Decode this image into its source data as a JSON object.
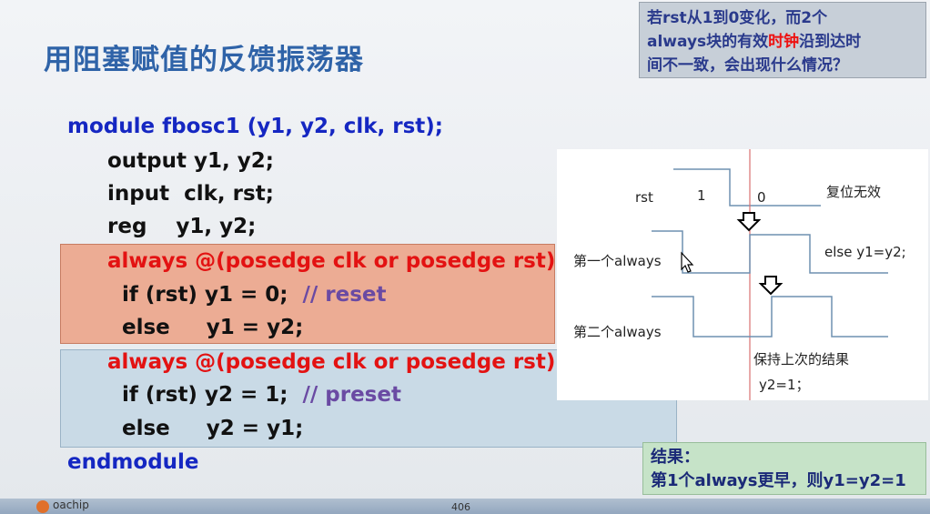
{
  "title": "用阻塞赋值的反馈振荡器",
  "note": {
    "line1": "若rst从1到0变化，而2个",
    "line2_pre": "always块的有效",
    "line2_red": "时钟",
    "line2_post": "沿到达时",
    "line3": "间不一致，会出现什么情况？"
  },
  "code": {
    "line1": "module fbosc1 (y1, y2, clk, rst);",
    "line2": "output y1, y2;",
    "line3": "input  clk, rst;",
    "line4": "reg    y1, y2;",
    "always1": "always @(posedge clk or posedge rst)",
    "if1": "if (rst) y1 = 0;",
    "cm1": "// reset",
    "else1": "else     y1 = y2;",
    "always2": "always @(posedge clk or posedge rst)",
    "if2": "if (rst) y2 = 1;",
    "cm2": "// preset",
    "else2": "else     y2 = y1;",
    "end": "endmodule"
  },
  "waveform": {
    "rst": "rst",
    "one": "1",
    "zero": "0",
    "reset_invalid": "复位无效",
    "first_always": "第一个always",
    "else_y1": "else y1=y2;",
    "second_always": "第二个always",
    "keep_last": "保持上次的结果",
    "y2_eq": "y2=1；"
  },
  "result": {
    "line1": "结果：",
    "line2": "第1个always更早，则y1=y2=1"
  },
  "footer": {
    "logo_text": "oachip",
    "page": "406"
  }
}
